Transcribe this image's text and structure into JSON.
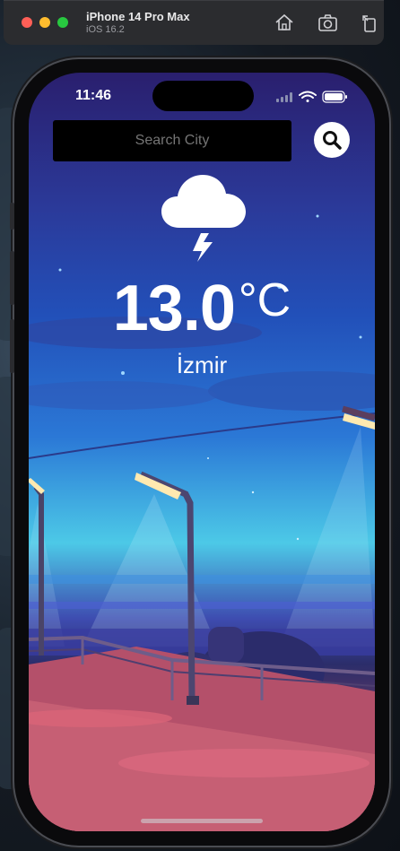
{
  "window": {
    "title": "iPhone 14 Pro Max",
    "subtitle": "iOS 16.2",
    "buttons": [
      "home-icon",
      "screenshot-icon",
      "rotate-icon"
    ]
  },
  "status_bar": {
    "time": "11:46",
    "icons": [
      "cellular-icon",
      "wifi-icon",
      "battery-icon"
    ]
  },
  "app": {
    "search": {
      "placeholder": "Search City",
      "value": ""
    },
    "search_button_icon": "search-icon",
    "weather_icon": "thunderstorm-cloud-icon",
    "temperature": "13.0",
    "unit": "°C",
    "city": "İzmir"
  },
  "colors": {
    "sky_top": "#2a1f6e",
    "sky_mid": "#2b78d6",
    "horizon": "#4cc9e7",
    "ground": "#c45a6f"
  }
}
